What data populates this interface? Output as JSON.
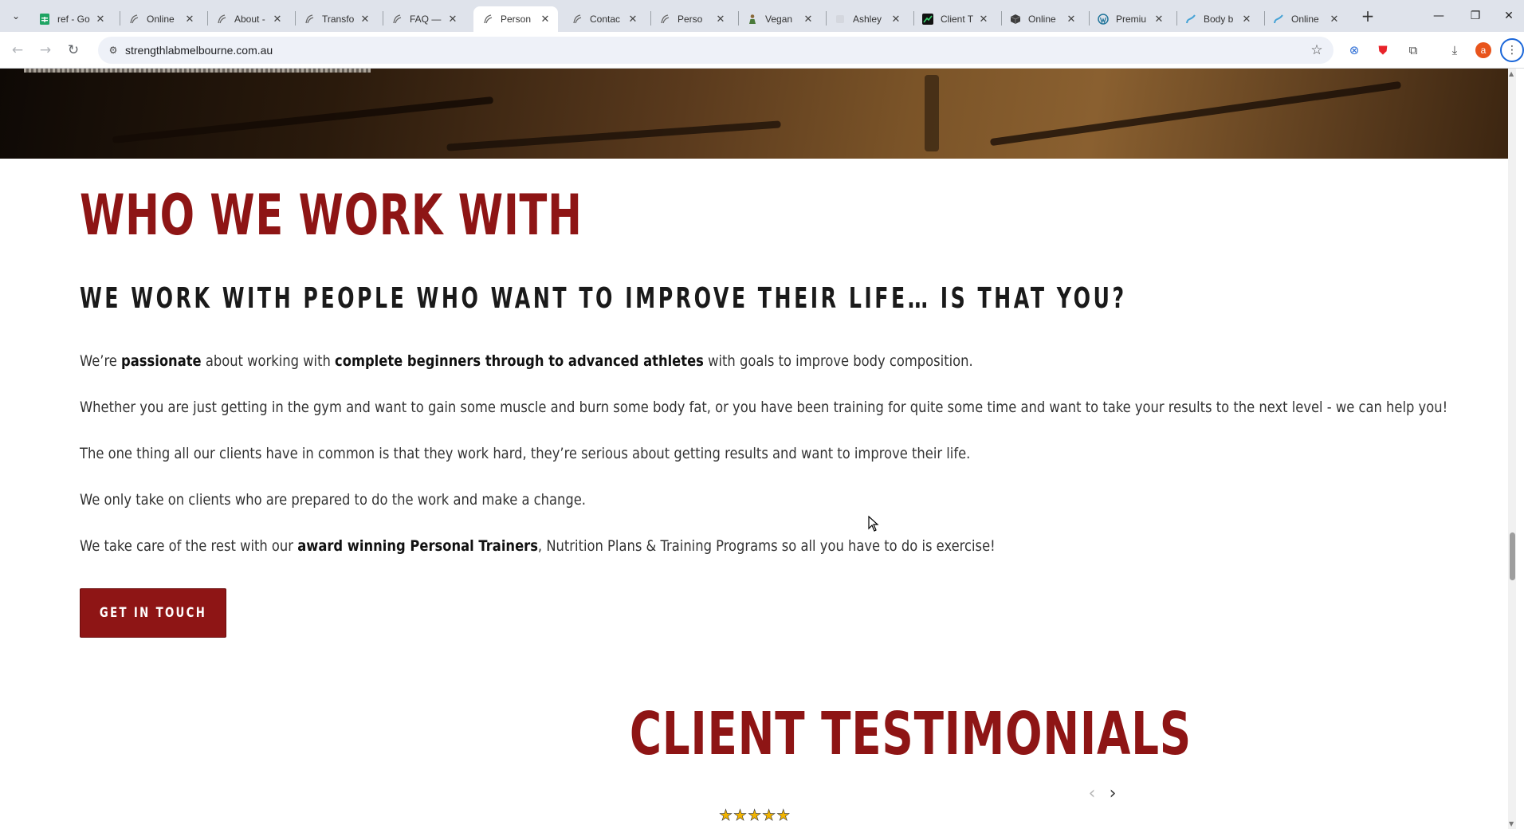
{
  "browser": {
    "tabs": [
      {
        "title": "ref - Go",
        "icon": "sheets-icon",
        "active": false
      },
      {
        "title": "Online",
        "icon": "site-logo-icon",
        "active": false
      },
      {
        "title": "About -",
        "icon": "site-logo-icon",
        "active": false
      },
      {
        "title": "Transfo",
        "icon": "site-logo-icon",
        "active": false
      },
      {
        "title": "FAQ —",
        "icon": "site-logo-icon",
        "active": false
      },
      {
        "title": "Person",
        "icon": "site-logo-icon",
        "active": true
      },
      {
        "title": "Contac",
        "icon": "site-logo-icon",
        "active": false
      },
      {
        "title": "Perso",
        "icon": "site-logo-icon",
        "active": false
      },
      {
        "title": "Vegan",
        "icon": "person-icon",
        "active": false
      },
      {
        "title": "Ashley",
        "icon": "blank-icon",
        "active": false
      },
      {
        "title": "Client T",
        "icon": "chart-icon",
        "active": false
      },
      {
        "title": "Online",
        "icon": "cube-icon",
        "active": false
      },
      {
        "title": "Premiu",
        "icon": "wordpress-icon",
        "active": false
      },
      {
        "title": "Body b",
        "icon": "wave-icon",
        "active": false
      },
      {
        "title": "Online",
        "icon": "wave-icon",
        "active": false
      }
    ],
    "url": "strengthlabmelbourne.com.au",
    "profile_initial": "a"
  },
  "section": {
    "heading": "WHO WE WORK WITH",
    "subheading": "WE WORK WITH PEOPLE WHO WANT TO IMPROVE THEIR LIFE… IS THAT YOU?",
    "para1": {
      "t1": "We’re ",
      "b1": "passionate",
      "t2": " about working with ",
      "b2": "complete beginners through to advanced athletes",
      "t3": " with goals to improve body composition."
    },
    "para2": "Whether you are just getting in the gym and want to gain some muscle and burn some body fat, or you have been training for quite some time and want to take your results to the next level - we can help you!",
    "para3": "The one thing all our clients have in common is that they work hard, they’re serious about getting results and want to improve their life.",
    "para4": "We only take on clients who are prepared to do the work and make a change.",
    "para5": {
      "t1": "We take care of the rest with our ",
      "b1": "award winning Personal Trainers",
      "t2": ", Nutrition Plans & Training Programs so all you have to do is exercise!"
    },
    "cta": "GET IN TOUCH"
  },
  "testimonials": {
    "heading": "CLIENT TESTIMONIALS",
    "rating": 5,
    "rating_max": 5
  },
  "colors": {
    "brand_red": "#8e1515",
    "star": "#f2b400"
  }
}
